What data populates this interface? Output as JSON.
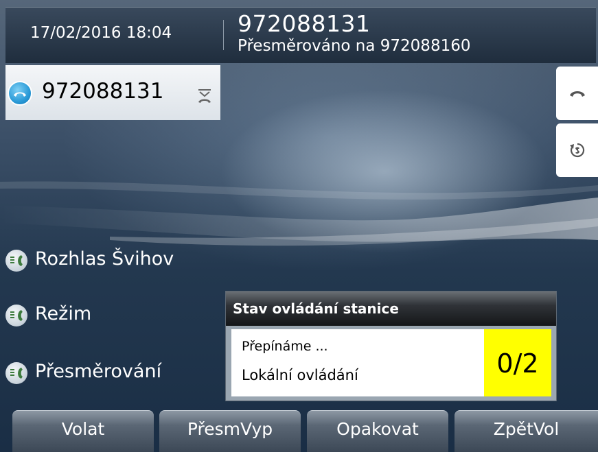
{
  "header": {
    "datetime": "17/02/2016 18:04",
    "caller_number": "972088131",
    "forward_status": "Přesměrováno na 972088160"
  },
  "line": {
    "number": "972088131",
    "icon": "handset-icon",
    "status_icon": "forward-all-icon"
  },
  "side_buttons": {
    "hangup_icon": "hangup-icon",
    "redial_icon": "redial-icon"
  },
  "speed_dials": [
    {
      "label": "Rozhlas Švihov",
      "icon": "speed-dial-icon"
    },
    {
      "label": "Režim",
      "icon": "speed-dial-icon"
    },
    {
      "label": "Přesměrování",
      "icon": "speed-dial-icon"
    }
  ],
  "popup": {
    "title": "Stav ovládání stanice",
    "line1": "Přepínáme ...",
    "line2": "Lokální ovládání",
    "counter": "0/2"
  },
  "softkeys": [
    "Volat",
    "PřesmVyp",
    "Opakovat",
    "ZpětVol"
  ],
  "colors": {
    "counter_highlight": "#ffff00",
    "line_icon_accent": "#2a9ad7"
  }
}
